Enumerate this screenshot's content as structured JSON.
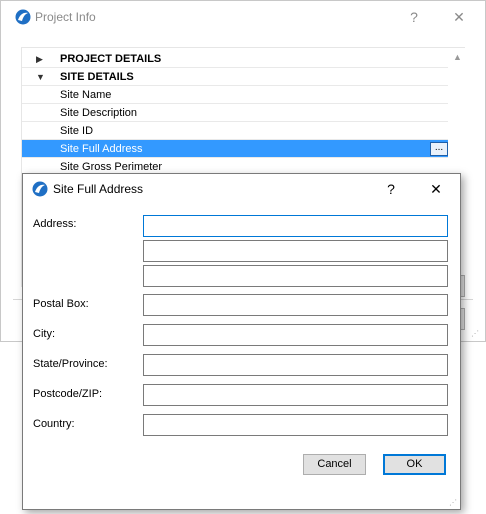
{
  "project_window": {
    "title": "Project Info",
    "help_label": "?",
    "close_label": "✕",
    "tree": [
      {
        "label": "PROJECT DETAILS",
        "kind": "category",
        "arrow": "▶"
      },
      {
        "label": "SITE DETAILS",
        "kind": "category",
        "arrow": "▼"
      },
      {
        "label": "Site Name",
        "kind": "item"
      },
      {
        "label": "Site Description",
        "kind": "item"
      },
      {
        "label": "Site ID",
        "kind": "item"
      },
      {
        "label": "Site Full Address",
        "kind": "item",
        "selected": true
      },
      {
        "label": "Site Gross Perimeter",
        "kind": "item"
      }
    ],
    "ellipsis_label": "...",
    "scroll_up_glyph": "▲"
  },
  "address_dialog": {
    "title": "Site Full Address",
    "help_label": "?",
    "close_label": "✕",
    "labels": {
      "address": "Address:",
      "postal_box": "Postal Box:",
      "city": "City:",
      "state": "State/Province:",
      "postcode": "Postcode/ZIP:",
      "country": "Country:"
    },
    "values": {
      "address_1": "",
      "address_2": "",
      "address_3": "",
      "postal_box": "",
      "city": "",
      "state": "",
      "postcode": "",
      "country": ""
    },
    "buttons": {
      "cancel": "Cancel",
      "ok": "OK"
    },
    "grip_glyph": "⋰"
  },
  "colors": {
    "selection": "#3399ff",
    "focus_border": "#0078d7",
    "logo_blue": "#1f6fc4"
  }
}
